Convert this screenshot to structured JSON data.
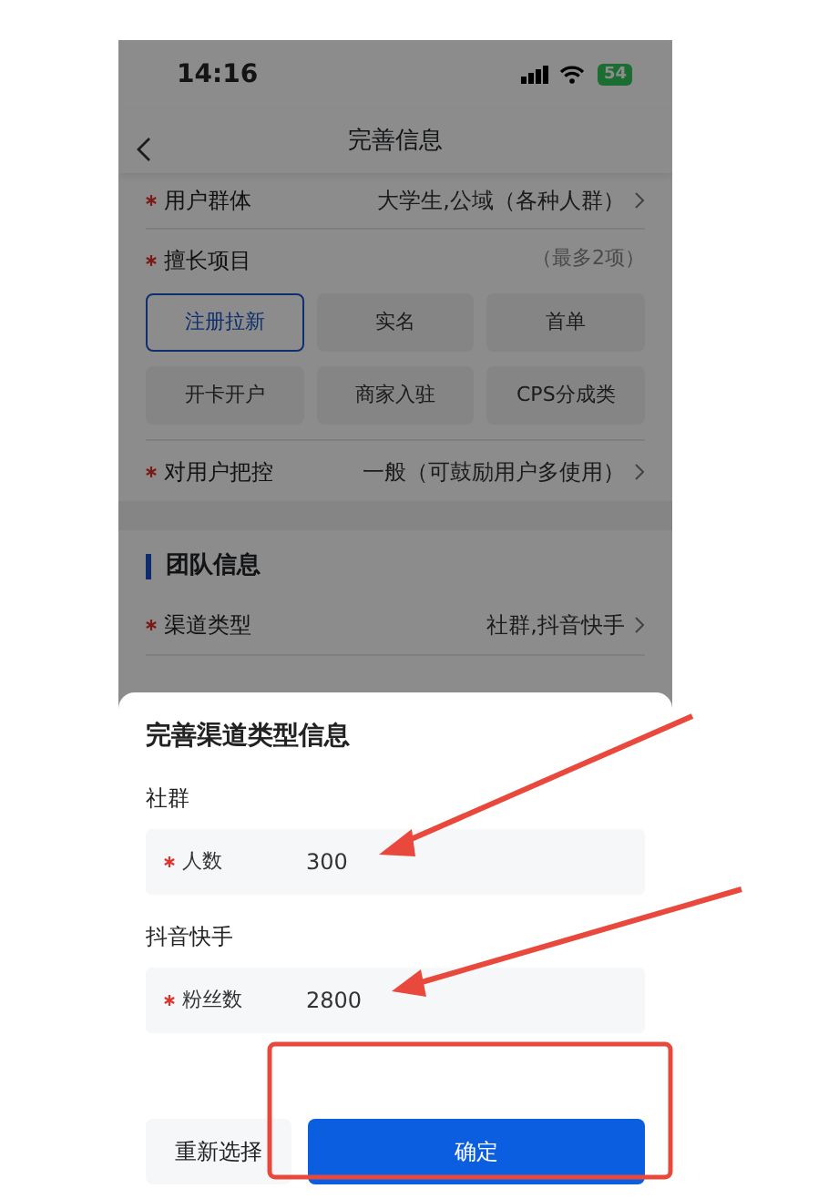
{
  "status_bar": {
    "time": "14:16",
    "battery": "54"
  },
  "nav": {
    "title": "完善信息"
  },
  "form": {
    "rows": [
      {
        "kind": "select",
        "label": "用户群体",
        "required": true,
        "value": "大学生,公域（各种人群）"
      },
      {
        "kind": "chips",
        "label": "擅长项目",
        "required": true,
        "hint": "（最多2项）",
        "chips": [
          {
            "label": "注册拉新",
            "selected": true
          },
          {
            "label": "实名",
            "selected": false
          },
          {
            "label": "首单",
            "selected": false
          },
          {
            "label": "开卡开户",
            "selected": false
          },
          {
            "label": "商家入驻",
            "selected": false
          },
          {
            "label": "CPS分成类",
            "selected": false
          }
        ]
      },
      {
        "kind": "select",
        "label": "对用户把控",
        "required": true,
        "value": "一般（可鼓励用户多使用）"
      }
    ]
  },
  "team_section": {
    "title": "团队信息",
    "rows": [
      {
        "kind": "select",
        "label": "渠道类型",
        "required": true,
        "value": "社群,抖音快手"
      }
    ]
  },
  "sheet": {
    "title": "完善渠道类型信息",
    "groups": [
      {
        "name": "社群",
        "field": {
          "label": "人数",
          "required": true,
          "value": "300"
        }
      },
      {
        "name": "抖音快手",
        "field": {
          "label": "粉丝数",
          "required": true,
          "value": "2800"
        }
      }
    ],
    "buttons": [
      {
        "label": "重新选择",
        "kind": "secondary"
      },
      {
        "label": "确定",
        "kind": "primary"
      }
    ]
  }
}
